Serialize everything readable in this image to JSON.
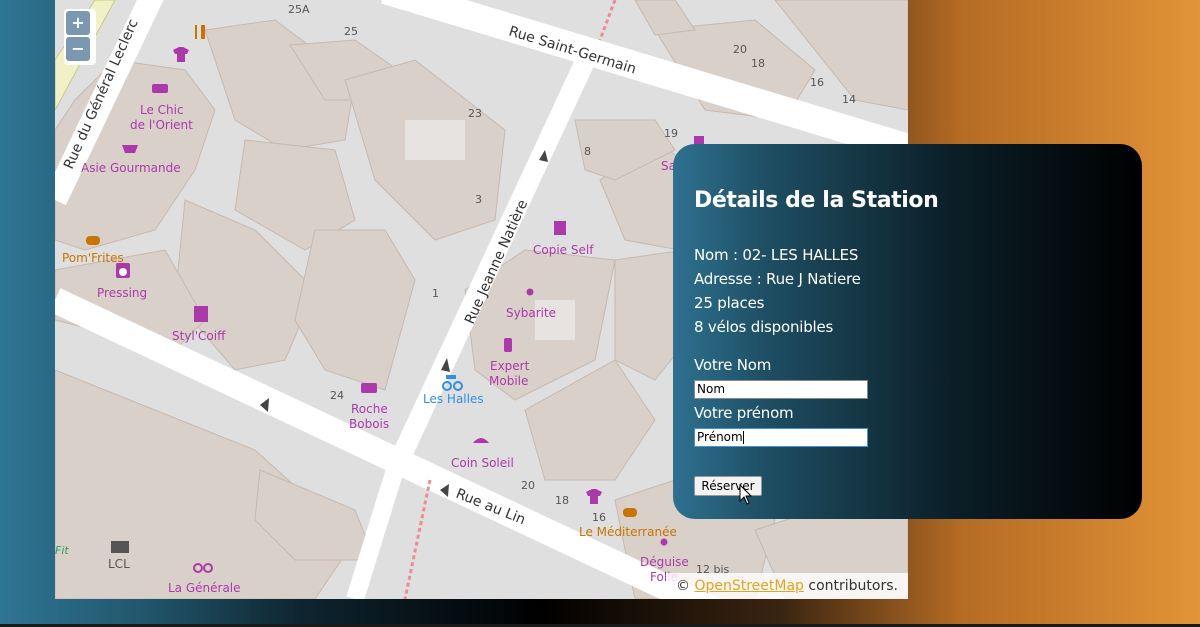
{
  "map": {
    "zoom_in_label": "+",
    "zoom_out_label": "−",
    "streets": {
      "saint_germain": "Rue Saint-Germain",
      "general_leclerc": "Rue du Général Leclerc",
      "jeanne_natiere": "Rue Jeanne Natière",
      "au_lin": "Rue au Lin"
    },
    "house_numbers": [
      "25A",
      "25",
      "23",
      "3",
      "1",
      "24",
      "8",
      "19",
      "20",
      "18",
      "16",
      "14",
      "20",
      "18",
      "16",
      "12 bis"
    ],
    "pois": {
      "chic_line1": "Le Chic",
      "chic_line2": "de l'Orient",
      "asie": "Asie Gourmande",
      "pomfrites": "Pom'Frites",
      "pressing": "Pressing",
      "stylcoiff": "Styl'Coiff",
      "roche_line1": "Roche",
      "roche_line2": "Bobois",
      "les_halles": "Les Halles",
      "copie_self": "Copie Self",
      "sybarite": "Sybarite",
      "expert_line1": "Expert",
      "expert_line2": "Mobile",
      "coin_soleil": "Coin Soleil",
      "mediterranee": "Le Méditerranée",
      "deguise_line1": "Déguise",
      "deguise_line2": "Folie",
      "lcl": "LCL",
      "generale": "La Générale",
      "fit": "Fit",
      "sa": "Sa"
    },
    "attribution": {
      "prefix": "© ",
      "link": "OpenStreetMap",
      "suffix": " contributors."
    }
  },
  "panel": {
    "title": "Détails de la Station",
    "name_line": "Nom : 02- LES HALLES",
    "address_line": "Adresse : Rue J Natiere",
    "places_line": "25 places",
    "bikes_line": "8 vélos disponibles",
    "nom_label": "Votre Nom",
    "nom_value": "Nom",
    "prenom_label": "Votre prénom",
    "prenom_value": "Prénom",
    "reserve_label": "Réserver"
  },
  "colors": {
    "poi_purple": "#ac39ac",
    "poi_orange": "#c77400",
    "poi_blue": "#2f8fe8",
    "link_orange": "#e6a31c"
  }
}
